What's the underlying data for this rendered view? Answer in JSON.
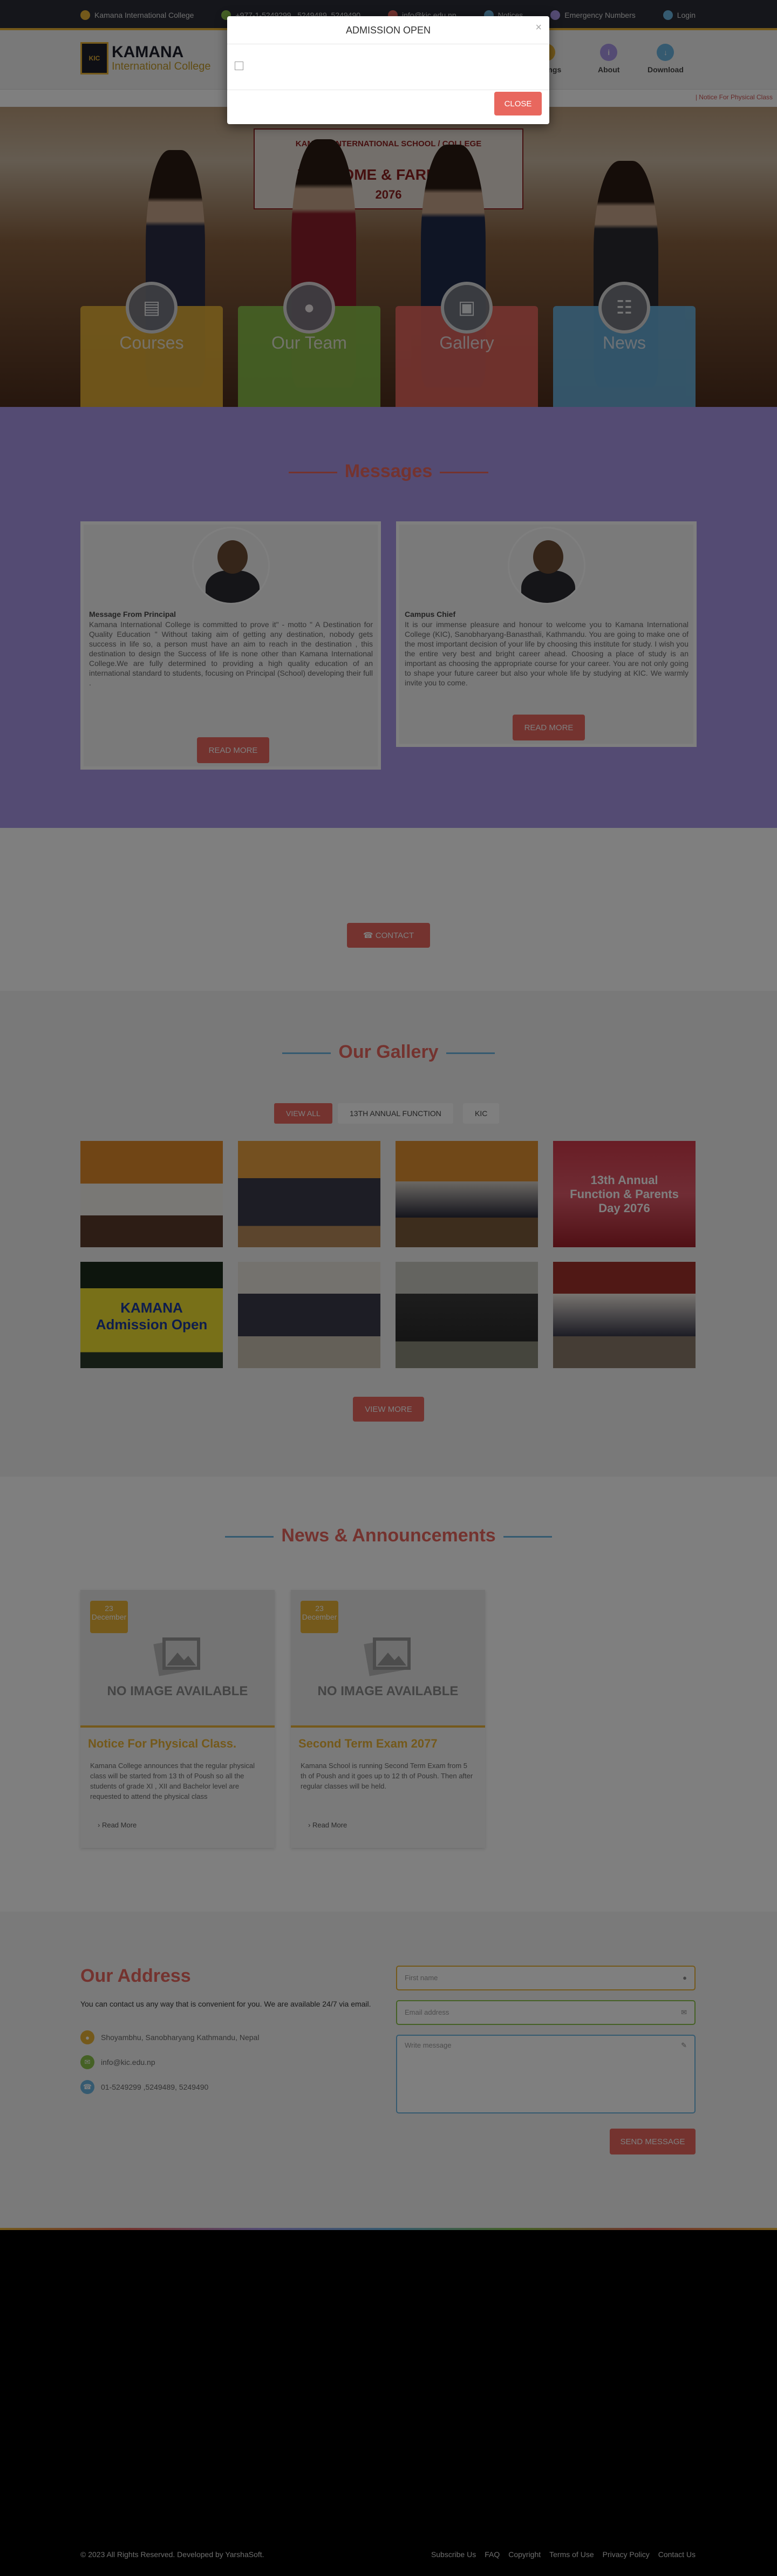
{
  "topbar": {
    "items": [
      {
        "label": "Kamana International College",
        "icon": "school-icon",
        "color": "#e8b337"
      },
      {
        "label": "+977-1-5249299 , 5249489, 5249490",
        "icon": "phone-icon",
        "color": "#8bc34a"
      },
      {
        "label": "info@kic.edu.np",
        "icon": "mail-icon",
        "color": "#e8675e"
      },
      {
        "label": "Notices",
        "icon": "bell-icon",
        "color": "#6bb4e0"
      },
      {
        "label": "Emergency Numbers",
        "icon": "alert-icon",
        "color": "#a896e6"
      },
      {
        "label": "Login",
        "icon": "user-icon",
        "color": "#6bb4e0"
      }
    ]
  },
  "logo": {
    "badge": "KIC",
    "name": "KAMANA",
    "sub": "International College"
  },
  "nav": [
    {
      "label": "Settings",
      "icon": "gear-icon",
      "color": "#e8b337"
    },
    {
      "label": "About",
      "icon": "info-icon",
      "color": "#a896e6"
    },
    {
      "label": "Download",
      "icon": "download-icon",
      "color": "#6bb4e0"
    }
  ],
  "ticker": "| Notice For Physical Class",
  "hero": {
    "banner_top": "KAMANA INTERNATIONAL SCHOOL / COLLEGE",
    "banner_mid": "WELCOME & FAREWELL",
    "banner_year": "2076"
  },
  "quick": [
    {
      "label": "Courses",
      "icon": "book-icon",
      "color": "#e8b337"
    },
    {
      "label": "Our Team",
      "icon": "team-icon",
      "color": "#8bc34a"
    },
    {
      "label": "Gallery",
      "icon": "image-icon",
      "color": "#e8675e"
    },
    {
      "label": "News",
      "icon": "newspaper-icon",
      "color": "#6bb4e0"
    }
  ],
  "modal": {
    "title": "ADMISSION OPEN",
    "close": "CLOSE",
    "x": "×"
  },
  "messages": {
    "title": "Messages",
    "cards": [
      {
        "title": "Message From Principal",
        "text": "Kamana International College is committed to prove it\" - motto \" A Destination for Quality Education \" Without taking aim of getting any destination, nobody gets success in life so, a person must have an aim to reach in the destination , this destination to design the Success of life is none other than Kamana International College.We are fully determined to providing a high quality education of an international standard to students, focusing on Principal (School) developing their full .",
        "button": "READ MORE"
      },
      {
        "title": "Campus Chief",
        "text": "It is our immense pleasure and honour to welcome you to Kamana International College (KIC), Sanobharyang-Banasthali, Kathmandu. You are going to make one of the most important decision of your life by choosing this institute for study. I wish you the entire very best and bright career ahead. Choosing a place of study is an important as choosing the appropriate course for your career. You are not only going to shape your future career but also your whole life by studying at KIC. We warmly invite you to come.",
        "button": "READ MORE"
      }
    ]
  },
  "contact_button": "CONTACT",
  "gallery": {
    "title": "Our Gallery",
    "tabs": [
      "VIEW ALL",
      "13TH ANNUAL FUNCTION",
      "KIC"
    ],
    "images": [
      {
        "alt": "Annual function students"
      },
      {
        "alt": "Annual function performance"
      },
      {
        "alt": "Annual function group"
      },
      {
        "alt": "13th Annual Function & Parents Day 2076",
        "caption": "13th Annual Function & Parents Day 2076"
      },
      {
        "alt": "Admission Open banner",
        "caption": "KAMANA Admission Open"
      },
      {
        "alt": "Students with banner"
      },
      {
        "alt": "Outdoor event"
      },
      {
        "alt": "Group photo"
      }
    ],
    "button": "VIEW MORE"
  },
  "news": {
    "title": "News & Announcements",
    "items": [
      {
        "day": "23",
        "month": "December",
        "noimg": "NO IMAGE AVAILABLE",
        "title": "Notice For Physical Class.",
        "text": "Kamana College announces that the regular physical class will be started from 13 th of Poush so all the students of grade XI , XII and Bachelor level are requested to attend the physical class",
        "more": "Read More"
      },
      {
        "day": "23",
        "month": "December",
        "noimg": "NO IMAGE AVAILABLE",
        "title": "Second Term Exam 2077",
        "text": "Kamana School is running Second Term Exam from 5 th of Poush and it goes up to 12 th of Poush. Then after regular classes will be held.",
        "more": "Read More"
      }
    ]
  },
  "address": {
    "title": "Our Address",
    "subtitle": "You can contact us any way that is convenient for you. We are available 24/7 via email.",
    "location": "Shoyambhu, Sanobharyang Kathmandu, Nepal",
    "email": "info@kic.edu.np",
    "phone": "01-5249299 ,5249489, 5249490",
    "form": {
      "name_ph": "First name",
      "email_ph": "Email address",
      "msg_ph": "Write message",
      "send": "SEND MESSAGE"
    },
    "colors": {
      "location": "#e8b337",
      "email": "#8bc34a",
      "phone": "#6bb4e0"
    }
  },
  "footer": {
    "copyright": "© 2023 All Rights Reserved. Developed by YarshaSoft.",
    "links": [
      "Subscribe Us",
      "FAQ",
      "Copyright",
      "Terms of Use",
      "Privacy Policy",
      "Contact Us"
    ]
  }
}
